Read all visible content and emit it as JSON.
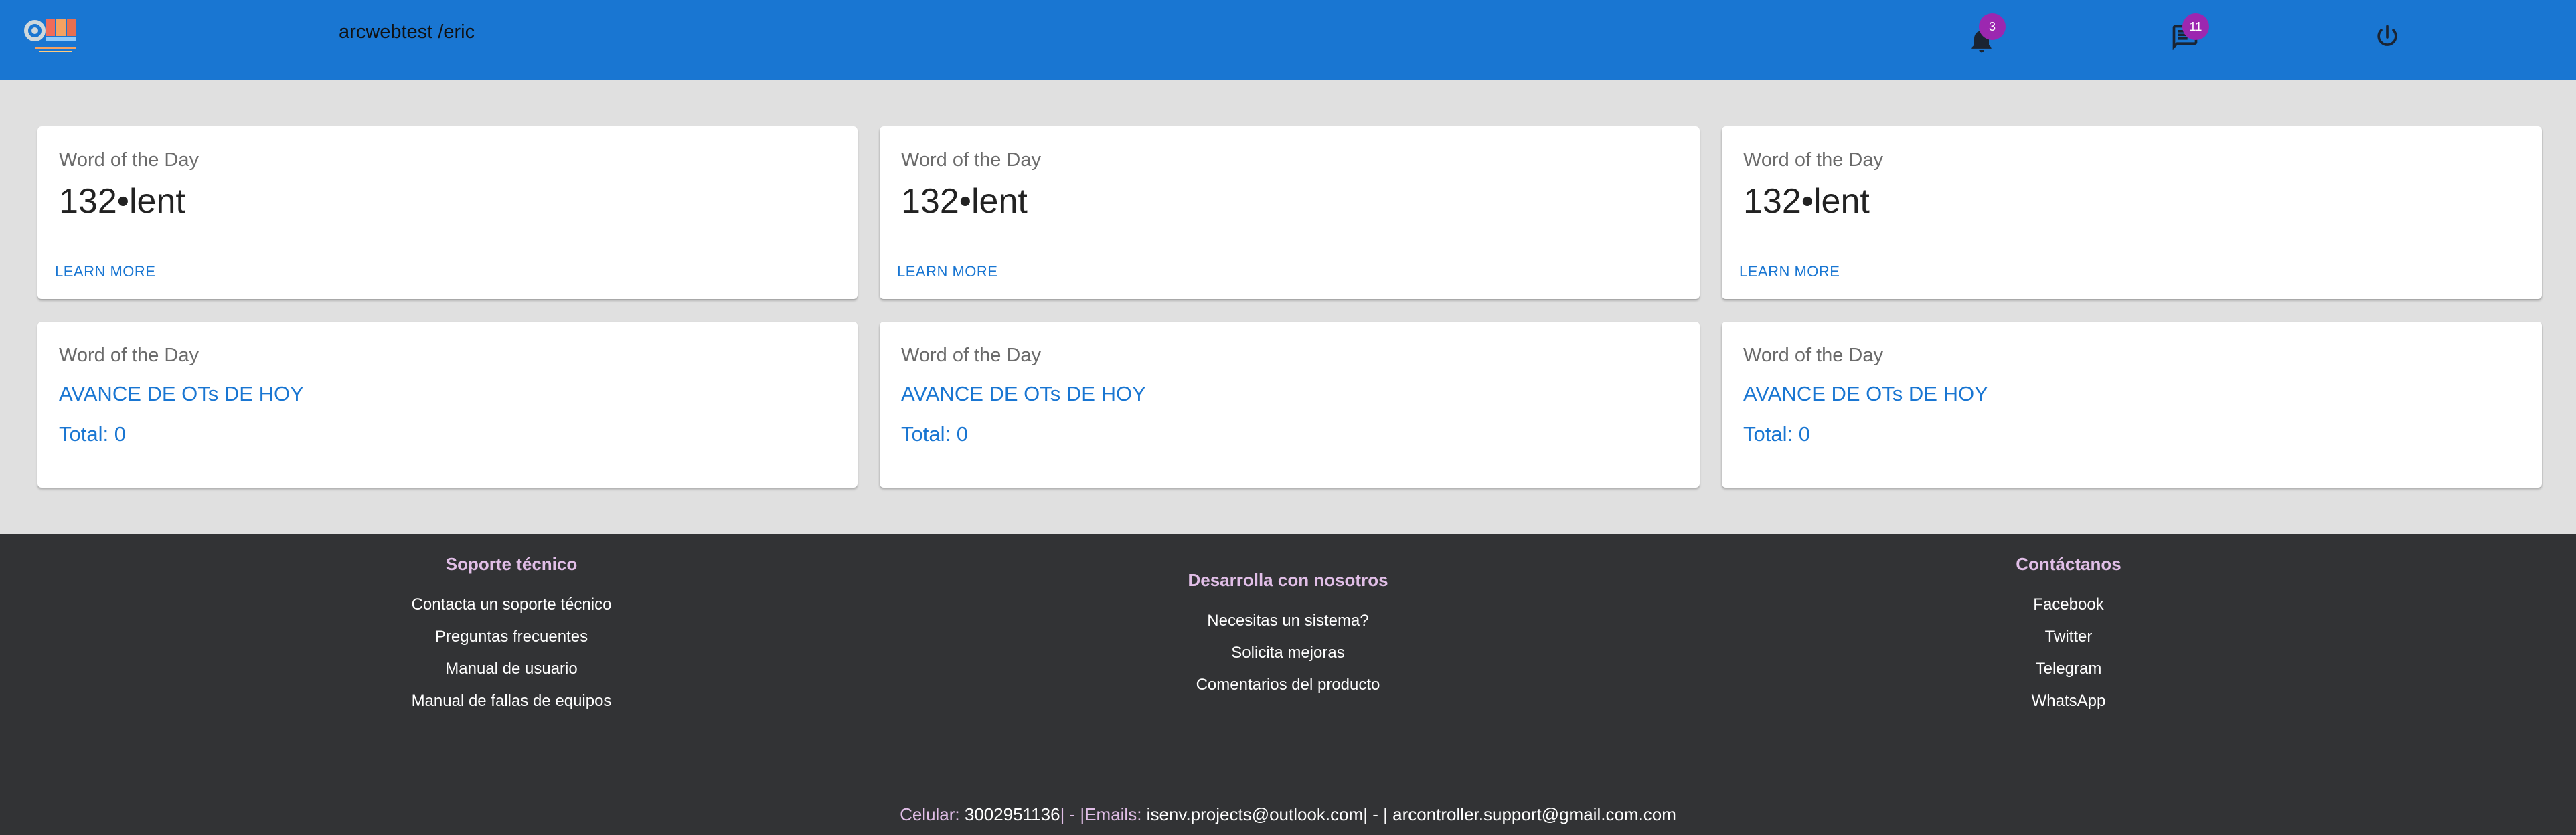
{
  "header": {
    "title": "arcwebtest /eric",
    "notifications_count": "3",
    "messages_count": "11",
    "colors": {
      "bar": "#1976d2",
      "badge": "#9c27b0"
    },
    "icons": [
      "logo",
      "bell-icon",
      "chat-icon",
      "power-icon"
    ]
  },
  "cards": [
    {
      "label": "Word of the Day",
      "word": "132•lent",
      "link": "LEARN MORE"
    },
    {
      "label": "Word of the Day",
      "word": "132•lent",
      "link": "LEARN MORE"
    },
    {
      "label": "Word of the Day",
      "word": "132•lent",
      "link": "LEARN MORE"
    },
    {
      "label": "Word of the Day",
      "heading": "AVANCE DE OTs DE HOY",
      "total": "Total: 0"
    },
    {
      "label": "Word of the Day",
      "heading": "AVANCE DE OTs DE HOY",
      "total": "Total: 0"
    },
    {
      "label": "Word of the Day",
      "heading": "AVANCE DE OTs DE HOY",
      "total": "Total: 0"
    }
  ],
  "footer": {
    "support": {
      "title": "Soporte técnico",
      "links": [
        "Contacta un soporte técnico",
        "Preguntas frecuentes",
        "Manual de usuario",
        "Manual de fallas de equipos"
      ]
    },
    "develop": {
      "title": "Desarrolla con nosotros",
      "links": [
        "Necesitas un sistema?",
        "Solicita mejoras",
        "Comentarios del producto"
      ]
    },
    "contact": {
      "title": "Contáctanos",
      "links": [
        "Facebook",
        "Twitter",
        "Telegram",
        "WhatsApp"
      ]
    },
    "contact_line": {
      "phone_label": "Celular:",
      "phone": "3002951136",
      "sep1": "| - |",
      "emails_label": "Emails:",
      "email1": "isenv.projects@outlook.com",
      "sep2": "| - |",
      "email2": "arcontroller.support@gmail.com.com"
    }
  }
}
